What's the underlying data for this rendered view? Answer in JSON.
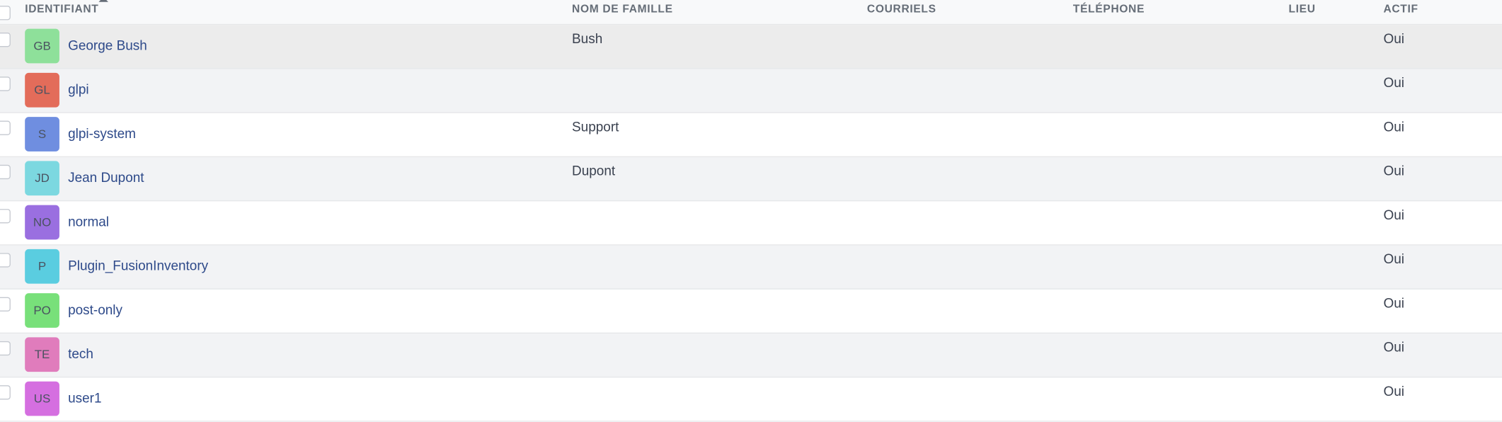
{
  "columns": {
    "login": "IDENTIFIANT",
    "lastname": "NOM DE FAMILLE",
    "emails": "COURRIELS",
    "phone": "TÉLÉPHONE",
    "location": "LIEU",
    "active": "ACTIF"
  },
  "rows": [
    {
      "initials": "GB",
      "login": "George Bush",
      "lastname": "Bush",
      "emails": "",
      "phone": "",
      "location": "",
      "active": "Oui",
      "color": "#8ee09a"
    },
    {
      "initials": "GL",
      "login": "glpi",
      "lastname": "",
      "emails": "",
      "phone": "",
      "location": "",
      "active": "Oui",
      "color": "#e36c5a"
    },
    {
      "initials": "S",
      "login": "glpi-system",
      "lastname": "Support",
      "emails": "",
      "phone": "",
      "location": "",
      "active": "Oui",
      "color": "#6f8ee0"
    },
    {
      "initials": "JD",
      "login": "Jean Dupont",
      "lastname": "Dupont",
      "emails": "",
      "phone": "",
      "location": "",
      "active": "Oui",
      "color": "#7cd8e0"
    },
    {
      "initials": "NO",
      "login": "normal",
      "lastname": "",
      "emails": "",
      "phone": "",
      "location": "",
      "active": "Oui",
      "color": "#9a6fe0"
    },
    {
      "initials": "P",
      "login": "Plugin_FusionInventory",
      "lastname": "",
      "emails": "",
      "phone": "",
      "location": "",
      "active": "Oui",
      "color": "#5acde0"
    },
    {
      "initials": "PO",
      "login": "post-only",
      "lastname": "",
      "emails": "",
      "phone": "",
      "location": "",
      "active": "Oui",
      "color": "#78e07a"
    },
    {
      "initials": "TE",
      "login": "tech",
      "lastname": "",
      "emails": "",
      "phone": "",
      "location": "",
      "active": "Oui",
      "color": "#e07cbc"
    },
    {
      "initials": "US",
      "login": "user1",
      "lastname": "",
      "emails": "",
      "phone": "",
      "location": "",
      "active": "Oui",
      "color": "#d56fe0"
    }
  ]
}
